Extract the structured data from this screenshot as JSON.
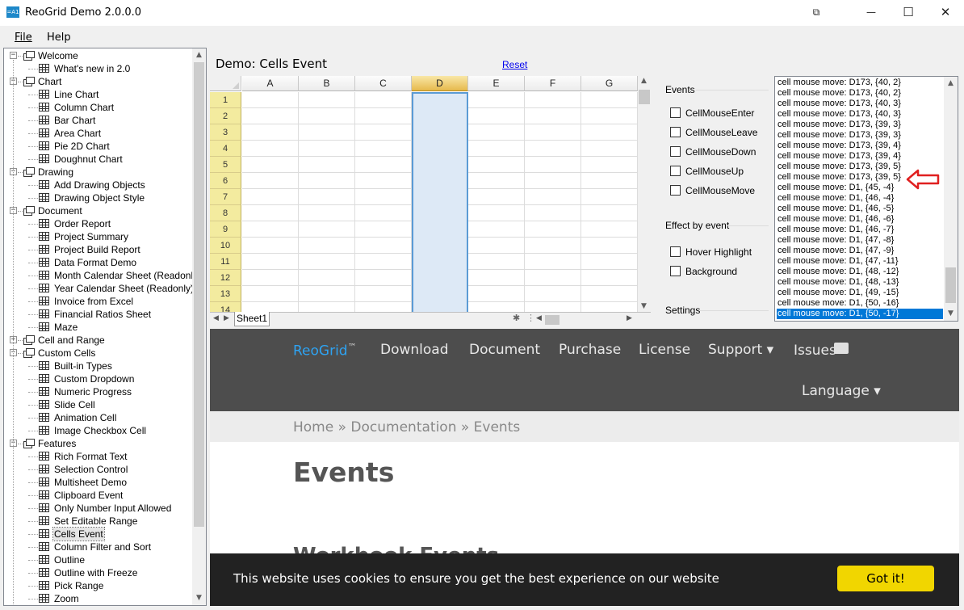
{
  "window": {
    "title": "ReoGrid Demo 2.0.0.0",
    "app_icon_text": "=A1",
    "buttons": {
      "restore": "⧉",
      "minimize": "—",
      "maximize": "☐",
      "close": "✕"
    }
  },
  "menu": {
    "file": "File",
    "help": "Help"
  },
  "tree": {
    "items": [
      {
        "label": "Welcome",
        "kind": "category"
      },
      {
        "label": "What's new in 2.0",
        "kind": "item"
      },
      {
        "label": "Chart",
        "kind": "category"
      },
      {
        "label": "Line Chart",
        "kind": "item"
      },
      {
        "label": "Column Chart",
        "kind": "item"
      },
      {
        "label": "Bar Chart",
        "kind": "item"
      },
      {
        "label": "Area Chart",
        "kind": "item"
      },
      {
        "label": "Pie 2D Chart",
        "kind": "item"
      },
      {
        "label": "Doughnut Chart",
        "kind": "item"
      },
      {
        "label": "Drawing",
        "kind": "category"
      },
      {
        "label": "Add Drawing Objects",
        "kind": "item"
      },
      {
        "label": "Drawing Object Style",
        "kind": "item"
      },
      {
        "label": "Document",
        "kind": "category"
      },
      {
        "label": "Order Report",
        "kind": "item"
      },
      {
        "label": "Project Summary",
        "kind": "item"
      },
      {
        "label": "Project Build Report",
        "kind": "item"
      },
      {
        "label": "Data Format Demo",
        "kind": "item"
      },
      {
        "label": "Month Calendar Sheet (Readonly)",
        "kind": "item"
      },
      {
        "label": "Year Calendar Sheet (Readonly)",
        "kind": "item"
      },
      {
        "label": "Invoice from Excel",
        "kind": "item"
      },
      {
        "label": "Financial Ratios Sheet",
        "kind": "item"
      },
      {
        "label": "Maze",
        "kind": "item"
      },
      {
        "label": "Cell and Range",
        "kind": "category-collapsed"
      },
      {
        "label": "Custom Cells",
        "kind": "category"
      },
      {
        "label": "Built-in Types",
        "kind": "item"
      },
      {
        "label": "Custom Dropdown",
        "kind": "item"
      },
      {
        "label": "Numeric Progress",
        "kind": "item"
      },
      {
        "label": "Slide Cell",
        "kind": "item"
      },
      {
        "label": "Animation Cell",
        "kind": "item"
      },
      {
        "label": "Image Checkbox Cell",
        "kind": "item"
      },
      {
        "label": "Features",
        "kind": "category"
      },
      {
        "label": "Rich Format Text",
        "kind": "item"
      },
      {
        "label": "Selection Control",
        "kind": "item"
      },
      {
        "label": "Multisheet Demo",
        "kind": "item"
      },
      {
        "label": "Clipboard Event",
        "kind": "item"
      },
      {
        "label": "Only Number Input Allowed",
        "kind": "item"
      },
      {
        "label": "Set Editable Range",
        "kind": "item"
      },
      {
        "label": "Cells Event",
        "kind": "item",
        "selected": true
      },
      {
        "label": "Column Filter and Sort",
        "kind": "item"
      },
      {
        "label": "Outline",
        "kind": "item"
      },
      {
        "label": "Outline with Freeze",
        "kind": "item"
      },
      {
        "label": "Pick Range",
        "kind": "item"
      },
      {
        "label": "Zoom",
        "kind": "item"
      }
    ]
  },
  "demo": {
    "title": "Demo: Cells Event",
    "reset": "Reset"
  },
  "sheet": {
    "columns": [
      "A",
      "B",
      "C",
      "D",
      "E",
      "F",
      "G"
    ],
    "active_column": "D",
    "rows": [
      "1",
      "2",
      "3",
      "4",
      "5",
      "6",
      "7",
      "8",
      "9",
      "10",
      "11",
      "12",
      "13",
      "14"
    ],
    "tab": "Sheet1"
  },
  "events_panel": {
    "events_label": "Events",
    "events": [
      "CellMouseEnter",
      "CellMouseLeave",
      "CellMouseDown",
      "CellMouseUp",
      "CellMouseMove"
    ],
    "effect_label": "Effect by event",
    "effects": [
      "Hover Highlight",
      "Background"
    ],
    "settings_label": "Settings"
  },
  "log": {
    "lines": [
      "cell mouse move: D173, {40,  2}",
      "cell mouse move: D173, {40,  2}",
      "cell mouse move: D173, {40,  3}",
      "cell mouse move: D173, {40,  3}",
      "cell mouse move: D173, {39,  3}",
      "cell mouse move: D173, {39,  3}",
      "cell mouse move: D173, {39,  4}",
      "cell mouse move: D173, {39,  4}",
      "cell mouse move: D173, {39,  5}",
      "cell mouse move: D173, {39,  5}",
      "cell mouse move: D1, {45, -4}",
      "cell mouse move: D1, {46, -4}",
      "cell mouse move: D1, {46, -5}",
      "cell mouse move: D1, {46, -6}",
      "cell mouse move: D1, {46, -7}",
      "cell mouse move: D1, {47, -8}",
      "cell mouse move: D1, {47, -9}",
      "cell mouse move: D1, {47, -11}",
      "cell mouse move: D1, {48, -12}",
      "cell mouse move: D1, {48, -13}",
      "cell mouse move: D1, {49, -15}",
      "cell mouse move: D1, {50, -16}",
      "cell mouse move: D1, {50, -17}"
    ],
    "selected_index": 22
  },
  "web": {
    "brand": "ReoGrid",
    "brand_tm": "™",
    "nav": [
      "Download",
      "Document",
      "Purchase",
      "License",
      "Support ▾",
      "Issues"
    ],
    "language": "Language ▾",
    "breadcrumb": "Home » Documentation » Events",
    "heading": "Events",
    "subheading": "Workbook Events",
    "cookie_text": "This website uses cookies to ensure you get the best experience on our website",
    "cookie_button": "Got it!"
  },
  "colors": {
    "accent_blue": "#0078d7",
    "brand_blue": "#2ea3f2",
    "cookie_button": "#f1d600",
    "arrow_red": "#e02020"
  }
}
